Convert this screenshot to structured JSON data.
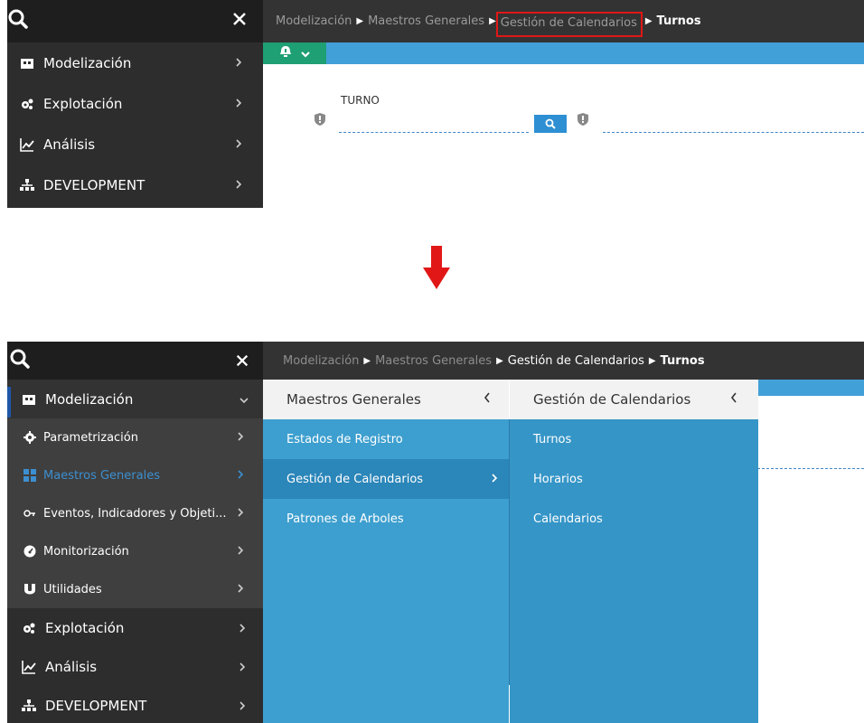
{
  "top": {
    "sidebar": {
      "items": [
        {
          "label": "Modelización",
          "icon": "dashboard-icon"
        },
        {
          "label": "Explotación",
          "icon": "gears-icon"
        },
        {
          "label": "Análisis",
          "icon": "line-chart-icon"
        },
        {
          "label": "DEVELOPMENT",
          "icon": "sitemap-icon"
        }
      ]
    },
    "breadcrumb": {
      "item1": "Modelización",
      "item2": "Maestros Generales",
      "item3": "Gestión de Calendarios",
      "current": "Turnos"
    },
    "form": {
      "field_label": "TURNO",
      "highlight_color": "#e11717"
    }
  },
  "bottom": {
    "sidebar": {
      "main_items": [
        {
          "label": "Modelización",
          "icon": "dashboard-icon"
        },
        {
          "label": "Explotación",
          "icon": "gears-icon"
        },
        {
          "label": "Análisis",
          "icon": "line-chart-icon"
        },
        {
          "label": "DEVELOPMENT",
          "icon": "sitemap-icon"
        }
      ],
      "sub_items": [
        {
          "label": "Parametrización",
          "icon": "gear-icon"
        },
        {
          "label": "Maestros Generales",
          "icon": "grid-icon"
        },
        {
          "label": "Eventos, Indicadores y Objeti...",
          "icon": "key-icon"
        },
        {
          "label": "Monitorización",
          "icon": "gauge-icon"
        },
        {
          "label": "Utilidades",
          "icon": "magnet-icon"
        }
      ]
    },
    "breadcrumb": {
      "item1": "Modelización",
      "item2": "Maestros Generales",
      "item3": "Gestión de Calendarios",
      "current": "Turnos"
    },
    "panel1": {
      "title": "Maestros Generales",
      "items": [
        "Estados de Registro",
        "Gestión de Calendarios",
        "Patrones de Arboles"
      ]
    },
    "panel2": {
      "title": "Gestión de Calendarios",
      "items": [
        "Turnos",
        "Horarios",
        "Calendarios"
      ]
    }
  },
  "colors": {
    "sidebar_bg": "#2d2d2d",
    "accent_blue": "#42a0d8",
    "panel_blue": "#3d9fcf",
    "toolbar_green": "#1e9f74",
    "arrow_red": "#e11717"
  }
}
